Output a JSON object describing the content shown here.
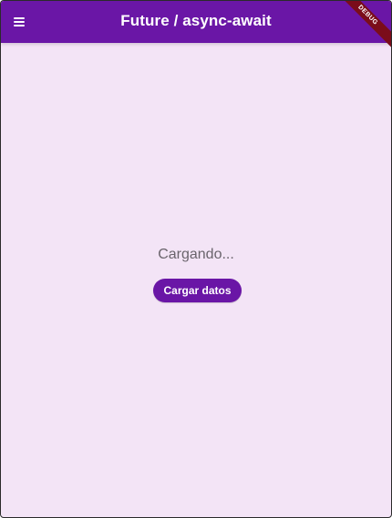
{
  "appbar": {
    "title": "Future / async-await",
    "menu_icon": "menu-icon",
    "debug_label": "DEBUG"
  },
  "main": {
    "status_text": "Cargando...",
    "button_label": "Cargar datos"
  },
  "colors": {
    "primary": "#6a16a6",
    "background": "#f3e4f6",
    "text_muted": "#6a646c",
    "debug_ribbon": "#7b0d1a"
  }
}
